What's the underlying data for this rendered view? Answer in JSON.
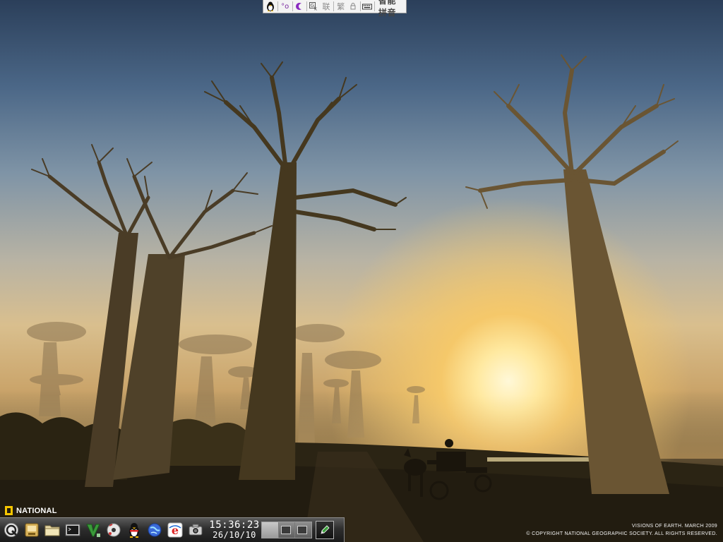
{
  "ime_toolbar": {
    "items": [
      {
        "name": "penguin-icon",
        "glyph": "🐧"
      },
      {
        "name": "punctuation-icon",
        "glyph": "°o"
      },
      {
        "name": "half-moon-icon",
        "glyph": "◢"
      },
      {
        "name": "soft-keyboard-icon",
        "glyph": "⌨"
      },
      {
        "name": "lock-icon",
        "glyph": "⋒"
      }
    ],
    "lian": "联",
    "fan": "繁",
    "name": "智能拼音"
  },
  "watermark": {
    "logo_text": "NATIONAL",
    "credit_line1": "VISIONS OF EARTH. MARCH 2009",
    "credit_line2": "© COPYRIGHT NATIONAL GEOGRAPHIC SOCIETY. ALL RIGHTS RESERVED."
  },
  "panel": {
    "launchers": [
      "app-menu-icon",
      "file-manager-icon",
      "folder-icon",
      "terminal-icon",
      "text-editor-icon",
      "media-player-icon",
      "qq-penguin-icon",
      "browser-globe-icon",
      "ie-browser-icon",
      "camera-icon"
    ],
    "clock": {
      "time": "15:36:23",
      "date": "26/10/10"
    },
    "pager": {
      "workspaces": 3,
      "active": 0
    }
  },
  "colors": {
    "panel_dark": "#1a1a1a",
    "sun": "#fff8d8",
    "natgeo_yellow": "#f6c600"
  }
}
